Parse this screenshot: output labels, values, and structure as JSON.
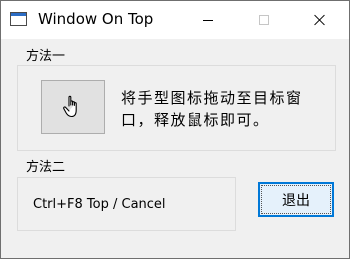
{
  "window": {
    "title": "Window On Top",
    "icons": {
      "app": "window-icon",
      "minimize": "minimize-icon",
      "maximize": "maximize-icon",
      "close": "close-icon"
    }
  },
  "method1": {
    "label": "方法一",
    "drag_icon": "hand-pointer-icon",
    "instruction": "将手型图标拖动至目标窗口，释放鼠标即可。"
  },
  "method2": {
    "label": "方法二",
    "hotkey_text": "Ctrl+F8  Top / Cancel"
  },
  "exit_button": {
    "label": "退出"
  },
  "colors": {
    "accent": "#0078d7",
    "background": "#f0f0f0",
    "button_face": "#e1e1e1"
  }
}
